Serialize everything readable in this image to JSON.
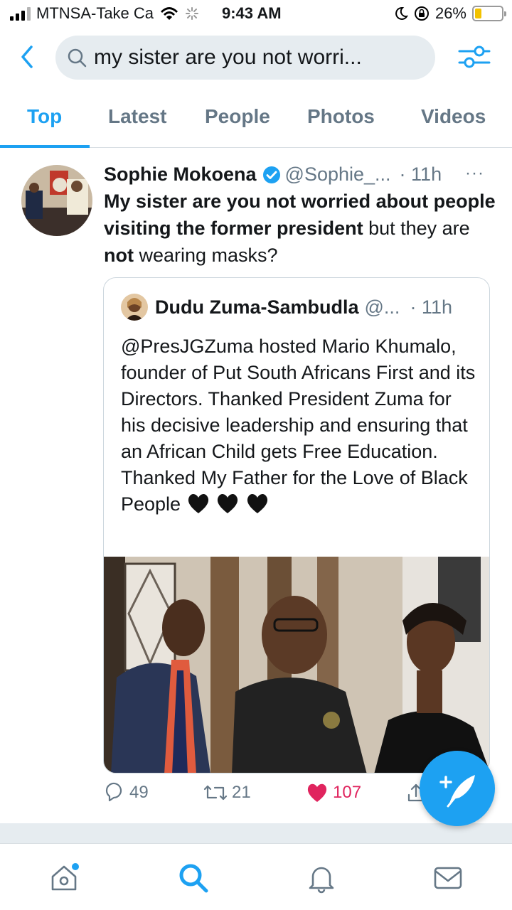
{
  "status_bar": {
    "carrier": "MTNSA-Take Ca",
    "time": "9:43 AM",
    "battery_percent": "26%",
    "battery_level": 0.26
  },
  "search": {
    "query": "my sister are you not worri..."
  },
  "tabs": [
    {
      "label": "Top",
      "active": true
    },
    {
      "label": "Latest",
      "active": false
    },
    {
      "label": "People",
      "active": false
    },
    {
      "label": "Photos",
      "active": false
    },
    {
      "label": "Videos",
      "active": false
    }
  ],
  "tweet": {
    "author_name": "Sophie Mokoena",
    "handle": "@Sophie_...",
    "time": "· 11h",
    "more": "···",
    "text": {
      "bold1": "My sister are you not worried about people visiting the former president",
      "plain1": " but they are ",
      "bold2": "not",
      "plain2": " wearing masks?"
    },
    "quote": {
      "author_name": "Dudu Zuma-Sambudla",
      "handle": "@...",
      "time": "· 11h",
      "text": "@PresJGZuma hosted Mario Khumalo, founder of Put South Africans First and its Directors. Thanked President Zuma for his decisive leadership and ensuring that an African Child gets Free Education. Thanked My Father for the Love of Black People"
    },
    "actions": {
      "replies": "49",
      "retweets": "21",
      "likes": "107"
    }
  },
  "colors": {
    "accent": "#1da1f2",
    "like": "#e0245e",
    "muted": "#657786"
  },
  "icons": {
    "back": "chevron-left-icon",
    "search": "search-icon",
    "filter": "sliders-icon",
    "verified": "verified-badge-icon",
    "reply": "reply-icon",
    "retweet": "retweet-icon",
    "like": "heart-icon",
    "share": "share-icon",
    "compose": "compose-tweet-icon",
    "home": "home-icon",
    "explore": "search-icon",
    "notifications": "bell-icon",
    "messages": "mail-icon"
  }
}
